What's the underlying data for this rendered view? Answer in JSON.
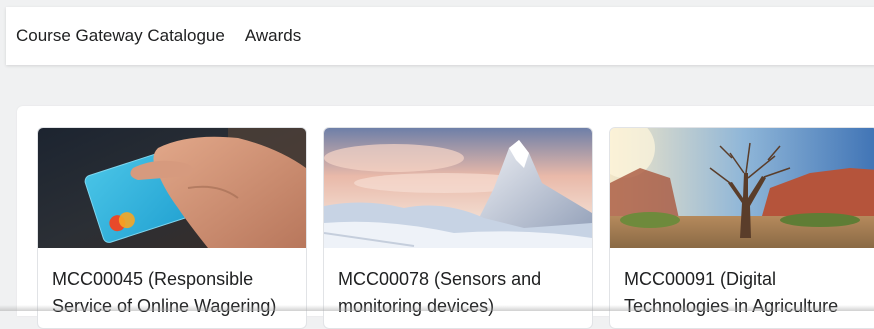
{
  "nav": {
    "items": [
      {
        "label": "Course Gateway Catalogue"
      },
      {
        "label": "Awards"
      }
    ]
  },
  "courses": [
    {
      "title": "MCC00045 (Responsible Service of Online Wagering)",
      "image": "credit-card-hand-image"
    },
    {
      "title": "MCC00078 (Sensors and monitoring devices)",
      "image": "snowy-mountain-image"
    },
    {
      "title": "MCC00091 (Digital Technologies in Agriculture",
      "image": "desert-tree-image"
    }
  ]
}
